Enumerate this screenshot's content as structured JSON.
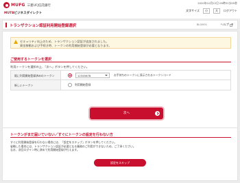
{
  "header": {
    "logo_text": "MUFG",
    "bank_name": "三菱UFJ信託銀行",
    "sub_brand_prefix": "MUTB",
    "sub_brand_suffix": "ビジネスダイレクト",
    "datetime": "2020年10月22日 09時31分05秒",
    "font_size_label": "文字サイズ",
    "font_size_small": "小",
    "font_size_large": "大",
    "logout_label": "ログアウト"
  },
  "titlebar": {
    "title": "トランザクション認証利用開始登録選択",
    "screen_code": "BLGI001",
    "help_label": "ヘルプ"
  },
  "notice": {
    "line1": "セキュリティ向上のため、トランザクション認証が追加されました。",
    "line2": "資金移動および手続き時、トークンの利用開始登録が必要となります。"
  },
  "token_section": {
    "title": "ご使用するトークンを選択",
    "description": "利用トークンを選択の上、「次へ」ボタンを押してください。",
    "rows": [
      {
        "label": "既に利用開始登録済みのトークン",
        "selected_value": "12345678",
        "hint": "お手持ちのトークンに表示されるトークンコード"
      },
      {
        "label": "新しいトークン",
        "option_label": "利用開始登録"
      }
    ],
    "next_button": "次へ"
  },
  "skip_section": {
    "title": "トークンがまだ届いていない／すぐにトークンの設定を行わない方",
    "line1": "すぐに利用開始登録を行わない場合には、「設定をスキップ」ボタンを押してください。",
    "line2": "省略した場合には、トランザクション認証が必要となる業務のご利用ができないため、ご了承ください。",
    "line3": "なお、次回ログイン時に改めて利用開始登録が行えます。",
    "skip_button": "設定をスキップ"
  },
  "colors": {
    "brand_red": "#c8102e",
    "notice_bg": "#fdf7e1",
    "warning_icon": "#e8a800"
  }
}
